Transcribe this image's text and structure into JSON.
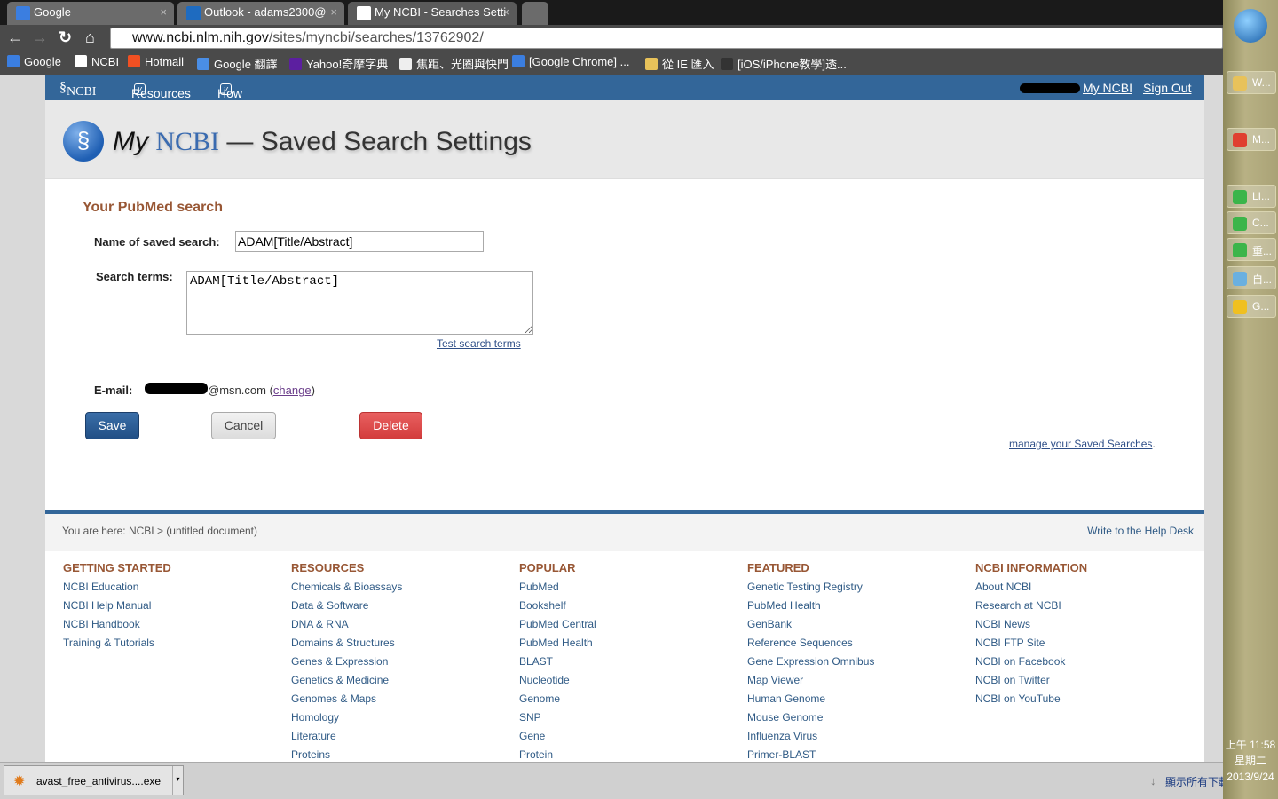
{
  "browser": {
    "tabs": [
      {
        "label": "Google",
        "color": "#3b7ee0"
      },
      {
        "label": "Outlook - adams2300@",
        "color": "#1e6bc0"
      },
      {
        "label": "My NCBI - Searches Setti",
        "color": "#fff"
      }
    ],
    "url_host": "www.ncbi.nlm.nih.gov",
    "url_path": "/sites/myncbi/searches/13762902/",
    "bookmarks": [
      {
        "label": "Google",
        "color": "#3b7ee0"
      },
      {
        "label": "NCBI",
        "color": "#fff"
      },
      {
        "label": "Hotmail",
        "color": "#f25022"
      },
      {
        "label": "Google 翻譯",
        "color": "#4a8ee6"
      },
      {
        "label": "Yahoo!奇摩字典",
        "color": "#5c1fa0"
      },
      {
        "label": "焦距、光圈與快門",
        "color": "#eee"
      },
      {
        "label": "[Google Chrome] ...",
        "color": "#3b7ee0"
      },
      {
        "label": "從 IE 匯入",
        "color": "#e8c25a"
      },
      {
        "label": "[iOS/iPhone教學]透...",
        "color": "#333"
      }
    ]
  },
  "ncbi": {
    "nav": {
      "logo": "NCBI",
      "resources": "Resources",
      "howto": "How To",
      "my_ncbi": "My NCBI",
      "sign_out": "Sign Out"
    },
    "title": {
      "my": "My",
      "ncbi": "NCBI",
      "rest": "— Saved Search Settings"
    },
    "form": {
      "heading": "Your PubMed search",
      "name_label": "Name of saved search:",
      "name_value": "ADAM[Title/Abstract]",
      "terms_label": "Search terms:",
      "terms_value": "ADAM[Title/Abstract]",
      "test_link": "Test search terms",
      "email_label": "E-mail:",
      "email_domain": "@msn.com",
      "change_open": "(",
      "change": "change",
      "change_close": ")",
      "save": "Save",
      "cancel": "Cancel",
      "delete": "Delete",
      "manage": "manage your Saved Searches",
      "manage_dot": "."
    },
    "footer": {
      "breadcrumb": "You are here: NCBI > (untitled document)",
      "help": "Write to the Help Desk",
      "columns": [
        {
          "title": "GETTING STARTED",
          "links": [
            "NCBI Education",
            "NCBI Help Manual",
            "NCBI Handbook",
            "Training & Tutorials"
          ]
        },
        {
          "title": "RESOURCES",
          "links": [
            "Chemicals & Bioassays",
            "Data & Software",
            "DNA & RNA",
            "Domains & Structures",
            "Genes & Expression",
            "Genetics & Medicine",
            "Genomes & Maps",
            "Homology",
            "Literature",
            "Proteins"
          ]
        },
        {
          "title": "POPULAR",
          "links": [
            "PubMed",
            "Bookshelf",
            "PubMed Central",
            "PubMed Health",
            "BLAST",
            "Nucleotide",
            "Genome",
            "SNP",
            "Gene",
            "Protein"
          ]
        },
        {
          "title": "FEATURED",
          "links": [
            "Genetic Testing Registry",
            "PubMed Health",
            "GenBank",
            "Reference Sequences",
            "Gene Expression Omnibus",
            "Map Viewer",
            "Human Genome",
            "Mouse Genome",
            "Influenza Virus",
            "Primer-BLAST"
          ]
        },
        {
          "title": "NCBI INFORMATION",
          "links": [
            "About NCBI",
            "Research at NCBI",
            "NCBI News",
            "NCBI FTP Site",
            "NCBI on Facebook",
            "NCBI on Twitter",
            "NCBI on YouTube"
          ]
        }
      ]
    }
  },
  "downloads": {
    "file": "avast_free_antivirus....exe",
    "show_all": "顯示所有下載"
  },
  "taskbar": {
    "items": [
      "W...",
      "M...",
      "LI...",
      "C...",
      "重...",
      "自...",
      "G..."
    ],
    "time": "上午 11:58",
    "weekday": "星期二",
    "date": "2013/9/24"
  }
}
